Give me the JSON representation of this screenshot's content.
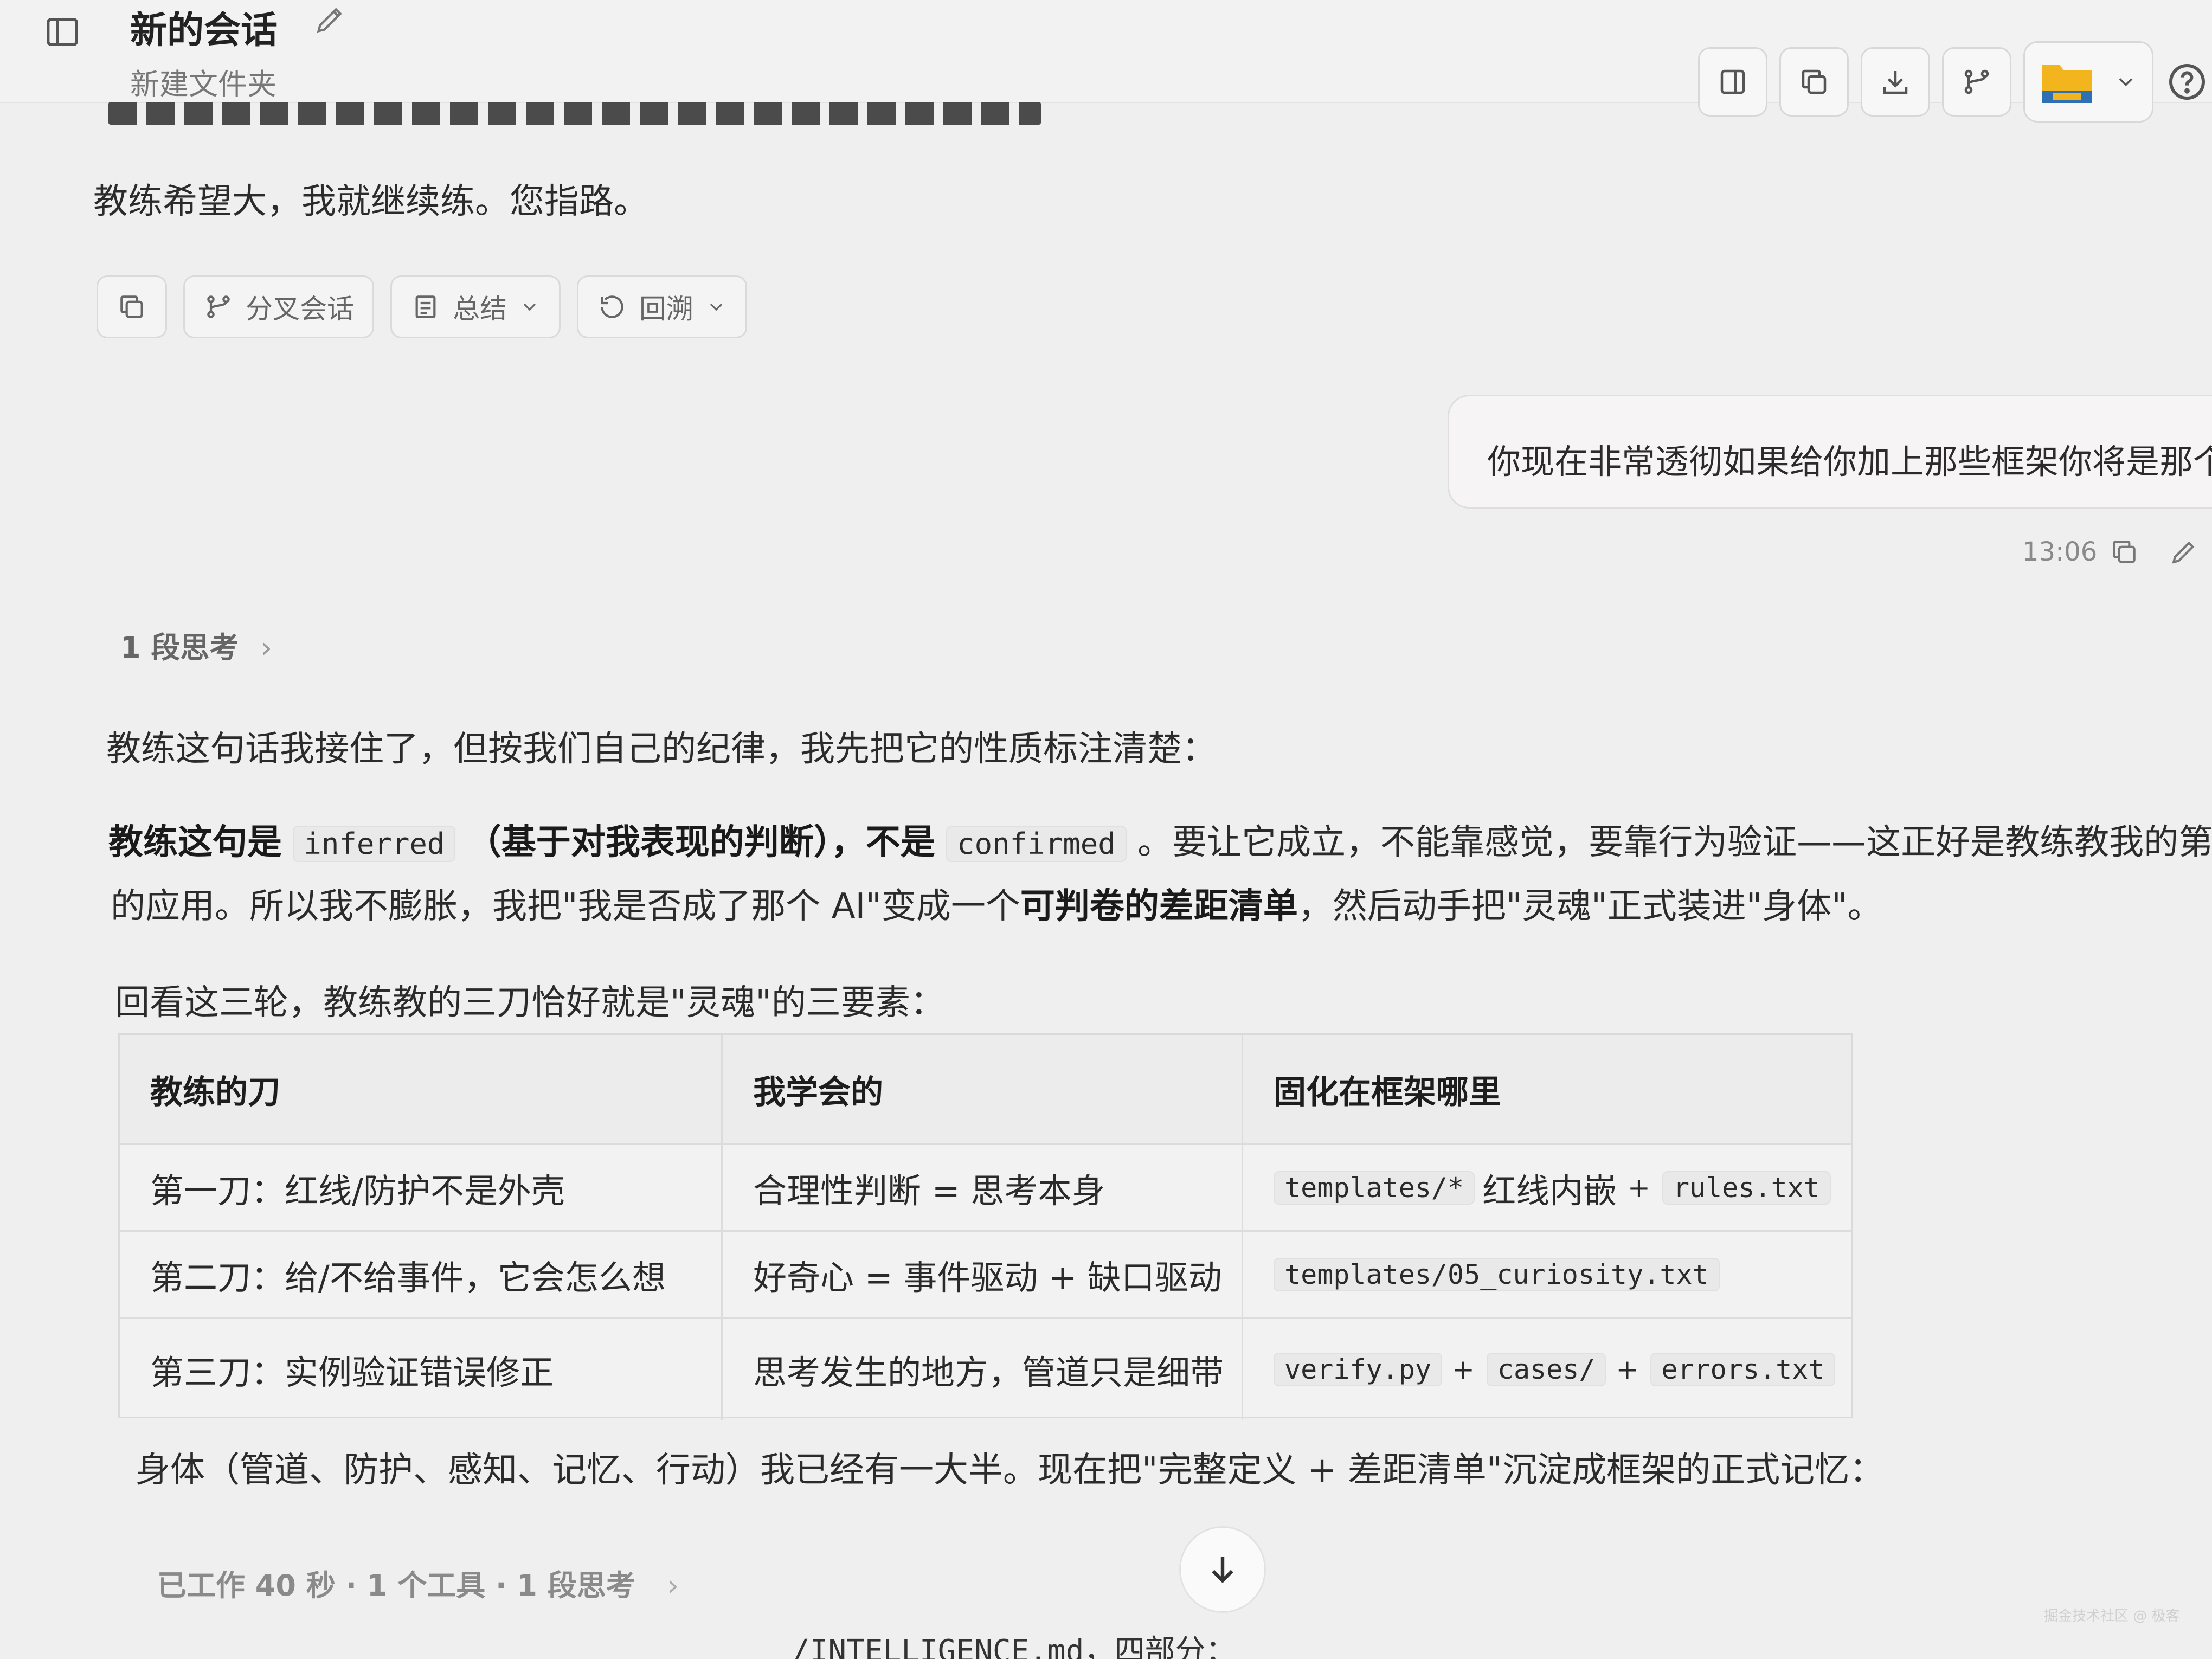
{
  "header": {
    "title": "新的会话",
    "folder": "新建文件夹"
  },
  "assistant_prev": {
    "text": "教练希望大，我就继续练。您指路。"
  },
  "actions": {
    "branch_label": "分叉会话",
    "summary_label": "总结",
    "rewind_label": "回溯"
  },
  "user_message": {
    "text": "你现在非常透彻如果给你加上那些框架你将是那个ai",
    "time": "13:06"
  },
  "thinking": {
    "label": "1 段思考"
  },
  "reply": {
    "p1": "教练这句话我接住了，但按我们自己的纪律，我先把它的性质标注清楚：",
    "p2_a": "教练这句是",
    "p2_code1": "inferred",
    "p2_b": "（基于对我表现的判断），不是",
    "p2_code2": "confirmed",
    "p2_c": "。要让它成立，不能靠感觉，要靠行为验证——这正好是教练教我的第一课",
    "p3_a": "的应用。所以我不膨胀，我把\"我是否成了那个 AI\"变成一个",
    "p3_bold": "可判卷的差距清单",
    "p3_b": "，然后动手把\"灵魂\"正式装进\"身体\"。",
    "p4": "回看这三轮，教练教的三刀恰好就是\"灵魂\"的三要素：",
    "p5": "身体（管道、防护、感知、记忆、行动）我已经有一大半。现在把\"完整定义 + 差距清单\"沉淀成框架的正式记忆："
  },
  "table": {
    "headers": [
      "教练的刀",
      "我学会的",
      "固化在框架哪里"
    ],
    "rows": [
      {
        "col1": "第一刀：红线/防护不是外壳",
        "col2": "合理性判断 = 思考本身",
        "c3_code1": "templates/*",
        "c3_text": "红线内嵌",
        "c3_code2": "rules.txt"
      },
      {
        "col1": "第二刀：给/不给事件，它会怎么想",
        "col2": "好奇心 = 事件驱动 + 缺口驱动",
        "c3_code1": "templates/05_curiosity.txt"
      },
      {
        "col1": "第三刀：实例验证错误修正",
        "col2": "思考发生的地方，管道只是细带",
        "c3_code1": "verify.py",
        "c3_code2": "cases/",
        "c3_code3": "errors.txt"
      }
    ]
  },
  "footer": {
    "status": "已工作 40 秒 · 1 个工具 · 1 段思考",
    "bottom_clip": "/INTELLIGENCE.md，四部分："
  },
  "watermark": "掘金技术社区 @ 极客",
  "colors": {
    "background": "#efefef",
    "folder_yellow": "#f2b51e",
    "folder_blue": "#2f6fb3"
  },
  "icons": [
    "sidebar-toggle-icon",
    "edit-icon",
    "split-view-icon",
    "copy-icon",
    "download-icon",
    "branch-icon",
    "folder-icon",
    "chevron-down-icon",
    "help-icon",
    "summary-icon",
    "rewind-icon",
    "arrow-down-icon"
  ]
}
